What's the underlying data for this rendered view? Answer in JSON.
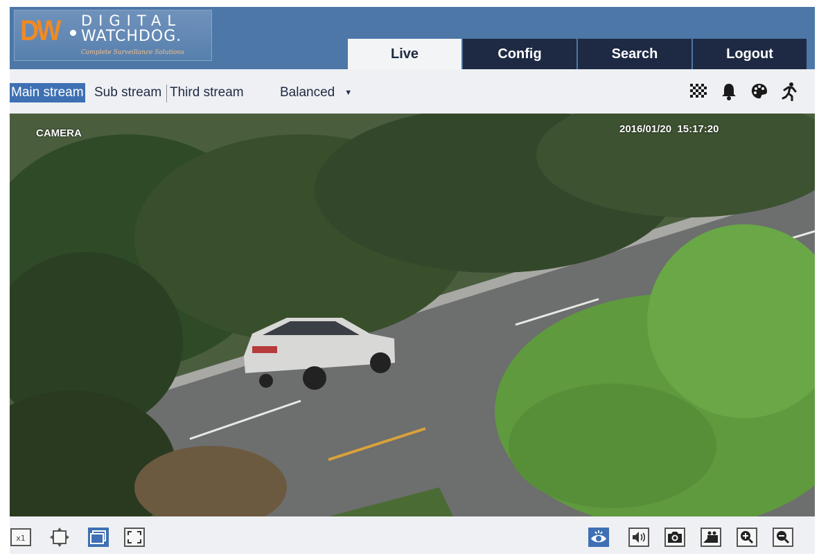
{
  "logo": {
    "mark": "DW",
    "wordmark_top": "DIGITAL",
    "wordmark_bottom": "WATCHDOG.",
    "tagline": "Complete Surveillance Solutions"
  },
  "nav": {
    "tabs": [
      {
        "label": "Live",
        "active": true
      },
      {
        "label": "Config",
        "active": false
      },
      {
        "label": "Search",
        "active": false
      },
      {
        "label": "Logout",
        "active": false
      }
    ]
  },
  "streams": {
    "items": [
      {
        "label": "Main stream",
        "active": true
      },
      {
        "label": "Sub stream",
        "active": false
      },
      {
        "label": "Third stream",
        "active": false
      }
    ],
    "quality": "Balanced"
  },
  "toolbar_icons": [
    "mosaic-icon",
    "alarm-bell-icon",
    "palette-icon",
    "motion-person-icon"
  ],
  "video": {
    "osd_name": "CAMERA",
    "osd_timestamp": "2016/01/20  15:17:20"
  },
  "bottom_icons_left": [
    "original-size-icon",
    "fit-ratio-icon",
    "window-mode-icon",
    "fullscreen-icon"
  ],
  "bottom_icons_right": [
    "live-view-icon",
    "audio-icon",
    "snapshot-icon",
    "record-icon",
    "zoom-in-icon",
    "zoom-out-icon"
  ],
  "colors": {
    "header_bg": "#4c77a7",
    "tab_bg": "#1e2a43",
    "active_tab_bg": "#f3f4f6",
    "accent": "#3e70b3",
    "logo_orange": "#f08a24"
  }
}
